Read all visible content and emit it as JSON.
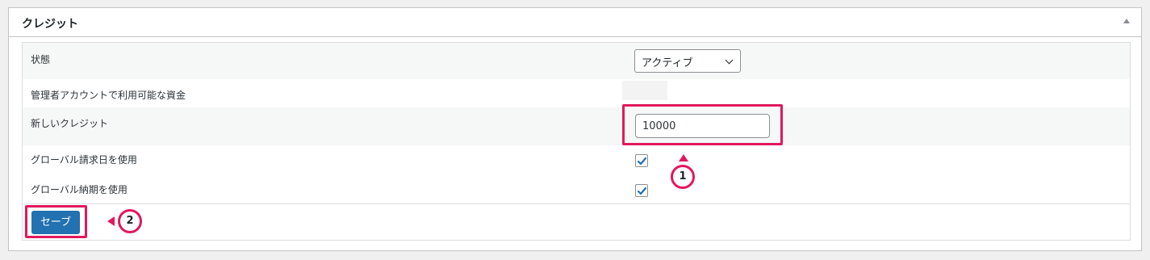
{
  "panel": {
    "title": "クレジット"
  },
  "fields": {
    "status": {
      "label": "状態",
      "selected": "アクティブ"
    },
    "admin_funds": {
      "label": "管理者アカウントで利用可能な資金"
    },
    "new_credit": {
      "label": "新しいクレジット",
      "value": "10000"
    },
    "global_billing_day": {
      "label": "グローバル請求日を使用",
      "checked": true
    },
    "global_due_date": {
      "label": "グローバル納期を使用",
      "checked": true
    }
  },
  "footer": {
    "save_label": "セーブ"
  },
  "annotations": {
    "callout_1": "1",
    "callout_2": "2",
    "highlight_color": "#e2185b"
  },
  "colors": {
    "primary_button": "#2271b1",
    "checkbox_check": "#2271b1"
  }
}
